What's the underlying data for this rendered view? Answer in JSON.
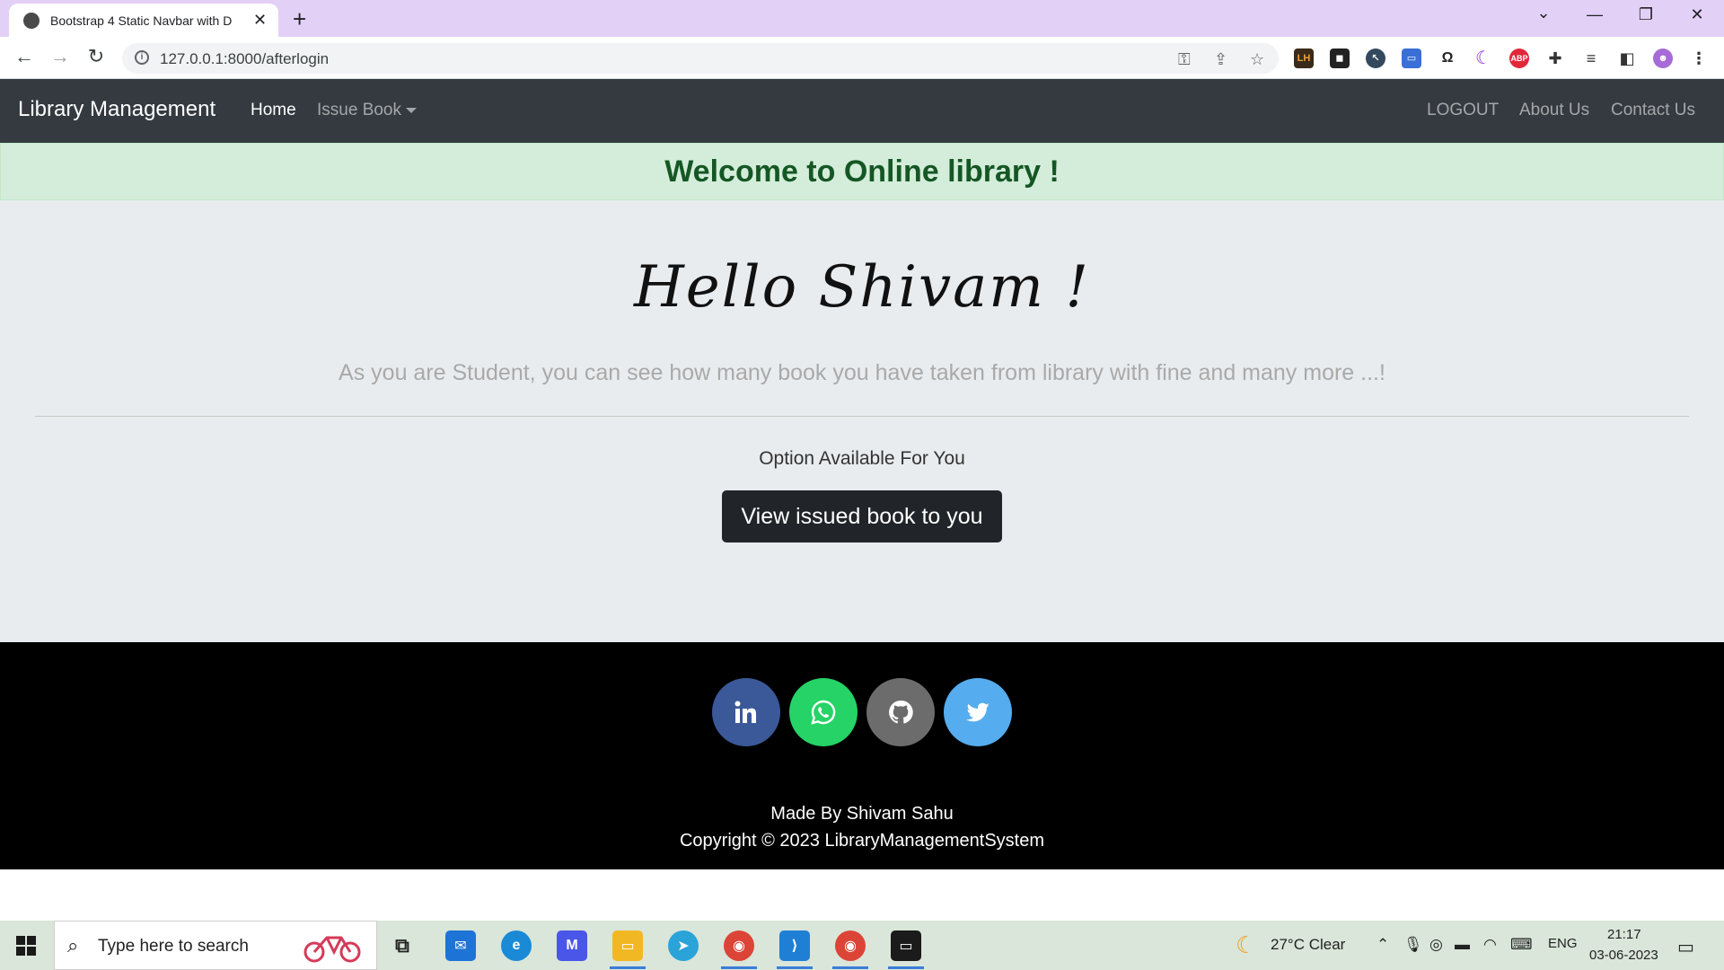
{
  "browser": {
    "tab_title": "Bootstrap 4 Static Navbar with D",
    "url": "127.0.0.1:8000/afterlogin"
  },
  "navbar": {
    "brand": "Library Management",
    "links": [
      "Home",
      "Issue Book",
      "LOGOUT",
      "About Us",
      "Contact Us"
    ]
  },
  "alert": {
    "text": "Welcome to Online library !"
  },
  "hero": {
    "greeting": "Hello Shivam !",
    "lead": "As you are Student, you can see how many book you have taken from library with fine and many more ...!",
    "options_label": "Option Available For You",
    "button_label": "View issued book to you"
  },
  "footer": {
    "social": [
      {
        "name": "linkedin",
        "icon": "linkedin-icon",
        "color": "#3b5998"
      },
      {
        "name": "whatsapp",
        "icon": "whatsapp-icon",
        "color": "#25d366"
      },
      {
        "name": "github",
        "icon": "github-icon",
        "color": "#6c6c6c"
      },
      {
        "name": "twitter",
        "icon": "twitter-icon",
        "color": "#55acee"
      }
    ],
    "made_by": "Made By Shivam Sahu",
    "copyright": "Copyright © 2023 LibraryManagementSystem"
  },
  "taskbar": {
    "search_placeholder": "Type here to search",
    "weather": "27°C  Clear",
    "language": "ENG",
    "time": "21:17",
    "date": "03-06-2023"
  },
  "colors": {
    "navbar_bg": "#343a40",
    "alert_bg": "#d4edda",
    "alert_text": "#155724",
    "jumbotron_bg": "#e9ecef",
    "button_bg": "#212529",
    "footer_bg": "#000000"
  }
}
